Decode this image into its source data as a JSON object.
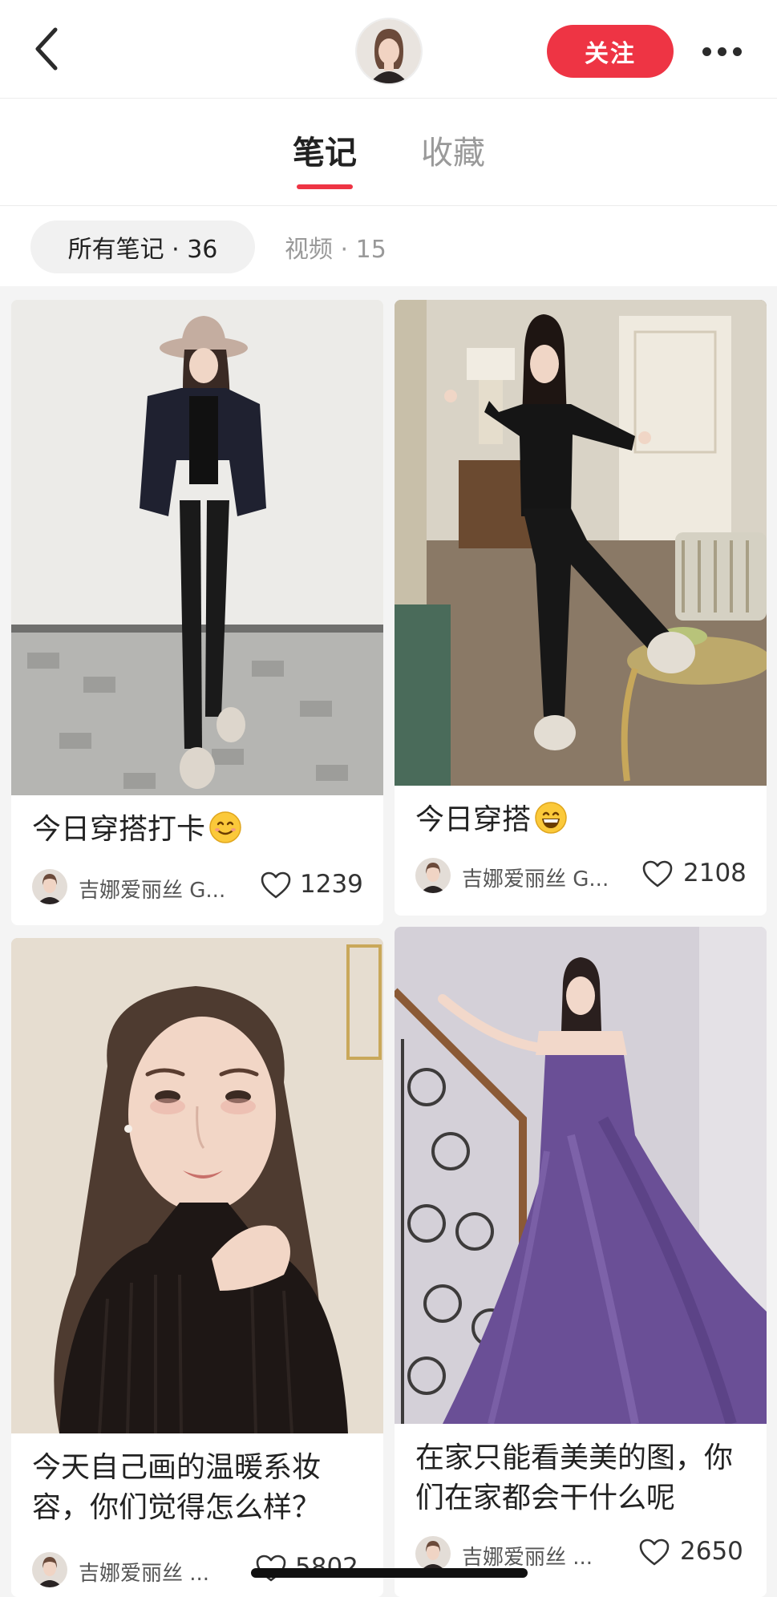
{
  "header": {
    "follow_label": "关注"
  },
  "tabs": [
    {
      "label": "笔记",
      "active": true
    },
    {
      "label": "收藏",
      "active": false
    }
  ],
  "filters": {
    "all": "所有笔记 · 36",
    "video": "视频 · 15"
  },
  "colors": {
    "accent": "#ee3444",
    "background": "#f4f4f4"
  },
  "notes": [
    {
      "title": "今日穿搭打卡",
      "emoji": "smiling-face",
      "author": "吉娜爱丽丝 G...",
      "likes": "1239"
    },
    {
      "title": "今日穿搭",
      "emoji": "grinning-face",
      "author": "吉娜爱丽丝 G...",
      "likes": "2108"
    },
    {
      "title": "今天自己画的温暖系妆容，你们觉得怎么样？",
      "author": "吉娜爱丽丝 ...",
      "likes": "5802"
    },
    {
      "title": "在家只能看美美的图，你们在家都会干什么呢",
      "author": "吉娜爱丽丝 ...",
      "likes": "2650"
    }
  ]
}
